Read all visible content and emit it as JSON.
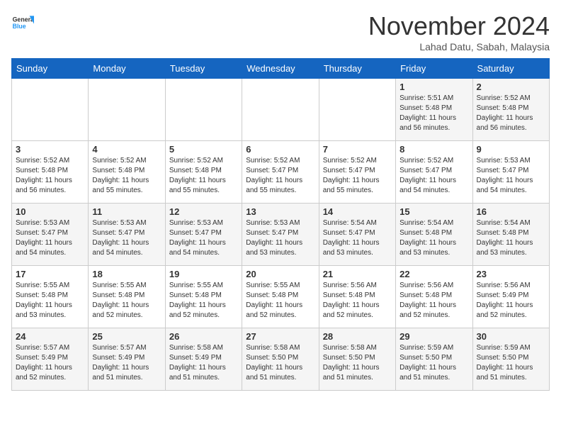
{
  "header": {
    "logo_general": "General",
    "logo_blue": "Blue",
    "month_title": "November 2024",
    "location": "Lahad Datu, Sabah, Malaysia"
  },
  "days_of_week": [
    "Sunday",
    "Monday",
    "Tuesday",
    "Wednesday",
    "Thursday",
    "Friday",
    "Saturday"
  ],
  "weeks": [
    [
      {
        "day": null
      },
      {
        "day": null
      },
      {
        "day": null
      },
      {
        "day": null
      },
      {
        "day": null
      },
      {
        "day": 1,
        "sunrise": "Sunrise: 5:51 AM",
        "sunset": "Sunset: 5:48 PM",
        "daylight": "Daylight: 11 hours and 56 minutes."
      },
      {
        "day": 2,
        "sunrise": "Sunrise: 5:52 AM",
        "sunset": "Sunset: 5:48 PM",
        "daylight": "Daylight: 11 hours and 56 minutes."
      }
    ],
    [
      {
        "day": 3,
        "sunrise": "Sunrise: 5:52 AM",
        "sunset": "Sunset: 5:48 PM",
        "daylight": "Daylight: 11 hours and 56 minutes."
      },
      {
        "day": 4,
        "sunrise": "Sunrise: 5:52 AM",
        "sunset": "Sunset: 5:48 PM",
        "daylight": "Daylight: 11 hours and 55 minutes."
      },
      {
        "day": 5,
        "sunrise": "Sunrise: 5:52 AM",
        "sunset": "Sunset: 5:48 PM",
        "daylight": "Daylight: 11 hours and 55 minutes."
      },
      {
        "day": 6,
        "sunrise": "Sunrise: 5:52 AM",
        "sunset": "Sunset: 5:47 PM",
        "daylight": "Daylight: 11 hours and 55 minutes."
      },
      {
        "day": 7,
        "sunrise": "Sunrise: 5:52 AM",
        "sunset": "Sunset: 5:47 PM",
        "daylight": "Daylight: 11 hours and 55 minutes."
      },
      {
        "day": 8,
        "sunrise": "Sunrise: 5:52 AM",
        "sunset": "Sunset: 5:47 PM",
        "daylight": "Daylight: 11 hours and 54 minutes."
      },
      {
        "day": 9,
        "sunrise": "Sunrise: 5:53 AM",
        "sunset": "Sunset: 5:47 PM",
        "daylight": "Daylight: 11 hours and 54 minutes."
      }
    ],
    [
      {
        "day": 10,
        "sunrise": "Sunrise: 5:53 AM",
        "sunset": "Sunset: 5:47 PM",
        "daylight": "Daylight: 11 hours and 54 minutes."
      },
      {
        "day": 11,
        "sunrise": "Sunrise: 5:53 AM",
        "sunset": "Sunset: 5:47 PM",
        "daylight": "Daylight: 11 hours and 54 minutes."
      },
      {
        "day": 12,
        "sunrise": "Sunrise: 5:53 AM",
        "sunset": "Sunset: 5:47 PM",
        "daylight": "Daylight: 11 hours and 54 minutes."
      },
      {
        "day": 13,
        "sunrise": "Sunrise: 5:53 AM",
        "sunset": "Sunset: 5:47 PM",
        "daylight": "Daylight: 11 hours and 53 minutes."
      },
      {
        "day": 14,
        "sunrise": "Sunrise: 5:54 AM",
        "sunset": "Sunset: 5:47 PM",
        "daylight": "Daylight: 11 hours and 53 minutes."
      },
      {
        "day": 15,
        "sunrise": "Sunrise: 5:54 AM",
        "sunset": "Sunset: 5:48 PM",
        "daylight": "Daylight: 11 hours and 53 minutes."
      },
      {
        "day": 16,
        "sunrise": "Sunrise: 5:54 AM",
        "sunset": "Sunset: 5:48 PM",
        "daylight": "Daylight: 11 hours and 53 minutes."
      }
    ],
    [
      {
        "day": 17,
        "sunrise": "Sunrise: 5:55 AM",
        "sunset": "Sunset: 5:48 PM",
        "daylight": "Daylight: 11 hours and 53 minutes."
      },
      {
        "day": 18,
        "sunrise": "Sunrise: 5:55 AM",
        "sunset": "Sunset: 5:48 PM",
        "daylight": "Daylight: 11 hours and 52 minutes."
      },
      {
        "day": 19,
        "sunrise": "Sunrise: 5:55 AM",
        "sunset": "Sunset: 5:48 PM",
        "daylight": "Daylight: 11 hours and 52 minutes."
      },
      {
        "day": 20,
        "sunrise": "Sunrise: 5:55 AM",
        "sunset": "Sunset: 5:48 PM",
        "daylight": "Daylight: 11 hours and 52 minutes."
      },
      {
        "day": 21,
        "sunrise": "Sunrise: 5:56 AM",
        "sunset": "Sunset: 5:48 PM",
        "daylight": "Daylight: 11 hours and 52 minutes."
      },
      {
        "day": 22,
        "sunrise": "Sunrise: 5:56 AM",
        "sunset": "Sunset: 5:48 PM",
        "daylight": "Daylight: 11 hours and 52 minutes."
      },
      {
        "day": 23,
        "sunrise": "Sunrise: 5:56 AM",
        "sunset": "Sunset: 5:49 PM",
        "daylight": "Daylight: 11 hours and 52 minutes."
      }
    ],
    [
      {
        "day": 24,
        "sunrise": "Sunrise: 5:57 AM",
        "sunset": "Sunset: 5:49 PM",
        "daylight": "Daylight: 11 hours and 52 minutes."
      },
      {
        "day": 25,
        "sunrise": "Sunrise: 5:57 AM",
        "sunset": "Sunset: 5:49 PM",
        "daylight": "Daylight: 11 hours and 51 minutes."
      },
      {
        "day": 26,
        "sunrise": "Sunrise: 5:58 AM",
        "sunset": "Sunset: 5:49 PM",
        "daylight": "Daylight: 11 hours and 51 minutes."
      },
      {
        "day": 27,
        "sunrise": "Sunrise: 5:58 AM",
        "sunset": "Sunset: 5:50 PM",
        "daylight": "Daylight: 11 hours and 51 minutes."
      },
      {
        "day": 28,
        "sunrise": "Sunrise: 5:58 AM",
        "sunset": "Sunset: 5:50 PM",
        "daylight": "Daylight: 11 hours and 51 minutes."
      },
      {
        "day": 29,
        "sunrise": "Sunrise: 5:59 AM",
        "sunset": "Sunset: 5:50 PM",
        "daylight": "Daylight: 11 hours and 51 minutes."
      },
      {
        "day": 30,
        "sunrise": "Sunrise: 5:59 AM",
        "sunset": "Sunset: 5:50 PM",
        "daylight": "Daylight: 11 hours and 51 minutes."
      }
    ]
  ]
}
